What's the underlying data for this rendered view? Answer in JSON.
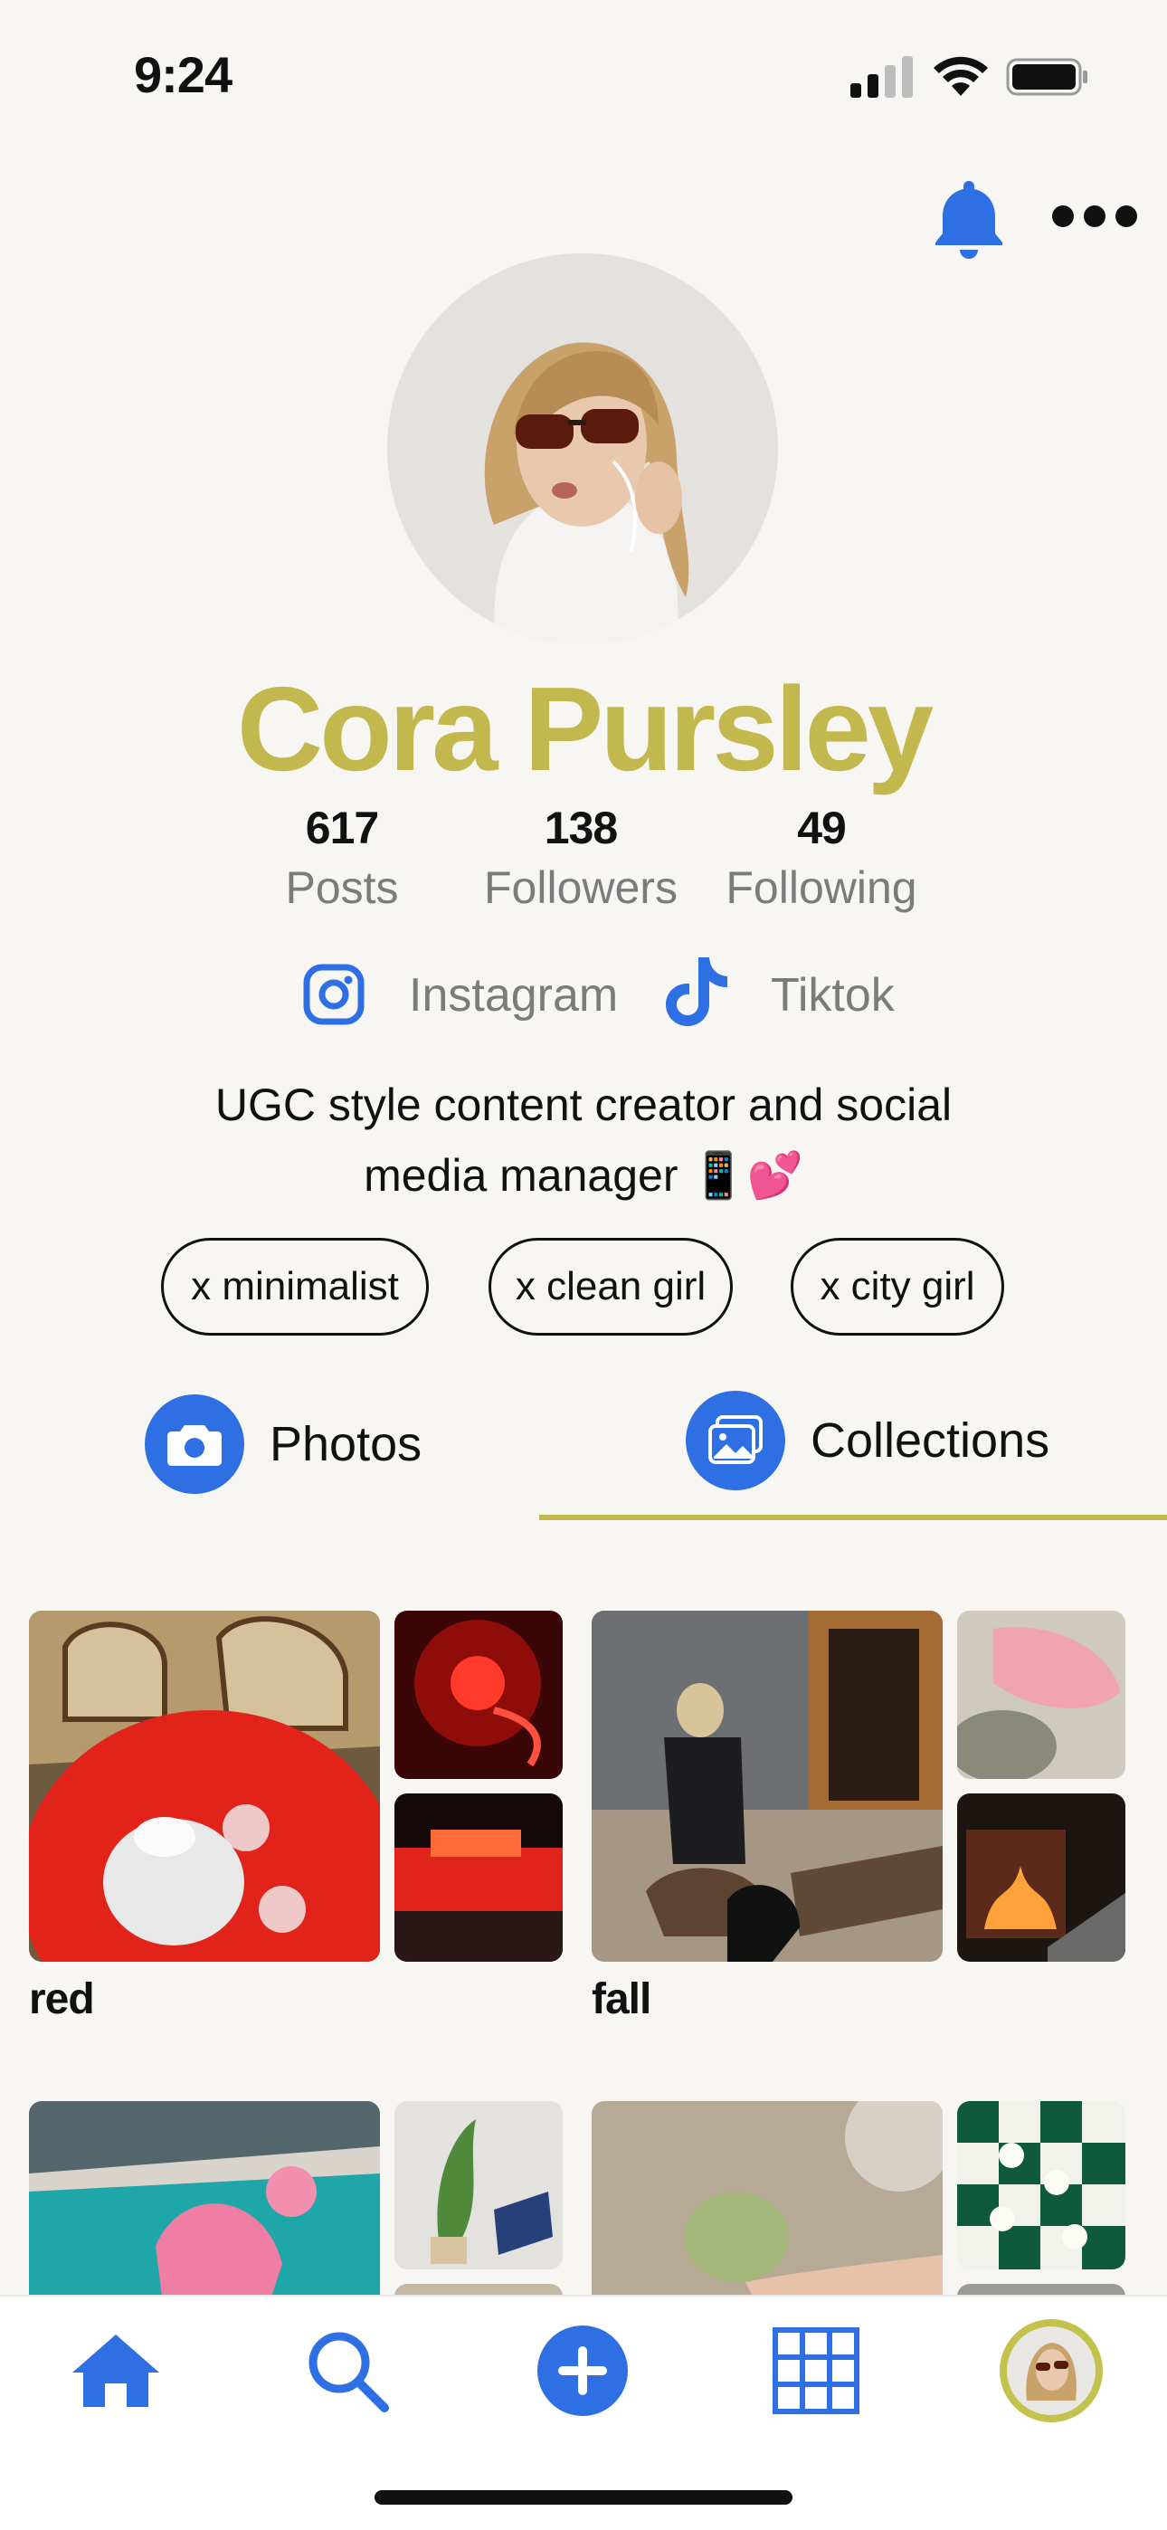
{
  "status_bar": {
    "time": "9:24"
  },
  "profile": {
    "name": "Cora Pursley",
    "stats": [
      {
        "value": "617",
        "label": "Posts"
      },
      {
        "value": "138",
        "label": "Followers"
      },
      {
        "value": "49",
        "label": "Following"
      }
    ],
    "socials": [
      {
        "icon": "instagram-icon",
        "label": "Instagram"
      },
      {
        "icon": "tiktok-icon",
        "label": "Tiktok"
      }
    ],
    "bio_line1": "UGC style content creator and social",
    "bio_line2": "media manager 📱💕",
    "tags": [
      "x minimalist",
      "x clean girl",
      "x city girl"
    ]
  },
  "tabs": {
    "photos": "Photos",
    "collections": "Collections",
    "active": "collections"
  },
  "collections": [
    {
      "title": "red"
    },
    {
      "title": "fall"
    }
  ],
  "bottom_nav": [
    "home-icon",
    "search-icon",
    "add-icon",
    "grid-icon",
    "profile-avatar"
  ],
  "colors": {
    "accent_blue": "#2f6fe4",
    "name_gold": "#c2b84d",
    "background": "#f8f6f3"
  }
}
